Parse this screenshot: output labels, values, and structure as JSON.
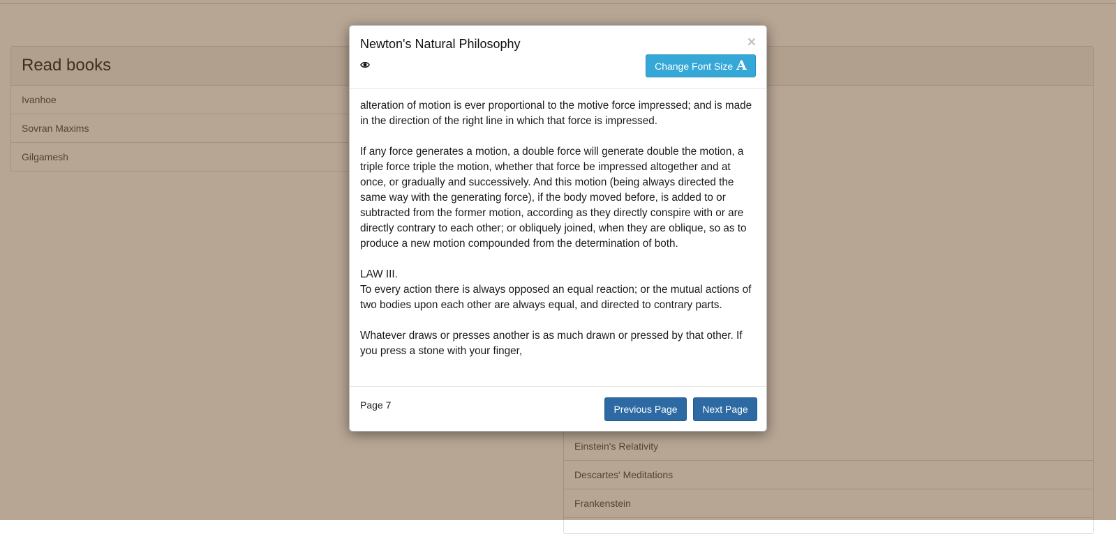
{
  "left_panel": {
    "heading": "Read books",
    "items": [
      "Ivanhoe",
      "Sovran Maxims",
      "Gilgamesh"
    ]
  },
  "right_panel": {
    "visible_items": [
      "Einstein's Relativity",
      "Descartes' Meditations",
      "Frankenstein"
    ]
  },
  "modal": {
    "title": "Newton's Natural Philosophy",
    "close_label": "×",
    "font_button_label": "Change Font Size",
    "font_button_icon": "A",
    "paragraphs": [
      "alteration of motion is ever proportional to the motive force impressed; and is made in the direction of the right line in which that force is impressed.",
      "If any force generates a motion, a double force will generate double the motion, a triple force triple the motion, whether that force be impressed altogether and at once, or gradually and successively. And this motion (being always directed the same way with the generating force), if the body moved before, is added to or subtracted from the former motion, according as they directly conspire with or are directly contrary to each other; or obliquely joined, when they are oblique, so as to produce a new motion compounded from the determination of both.",
      "LAW III.",
      "To every action there is always opposed an equal reaction; or the mutual actions of two bodies upon each other are always equal, and directed to contrary parts.",
      "Whatever draws or presses another is as much drawn or pressed by that other. If you press a stone with your finger,"
    ],
    "page_label": "Page 7",
    "prev_label": "Previous Page",
    "next_label": "Next Page"
  },
  "colors": {
    "overlay": "#b89f86",
    "info_button": "#35a8d8",
    "primary_button": "#2d6aa3"
  }
}
